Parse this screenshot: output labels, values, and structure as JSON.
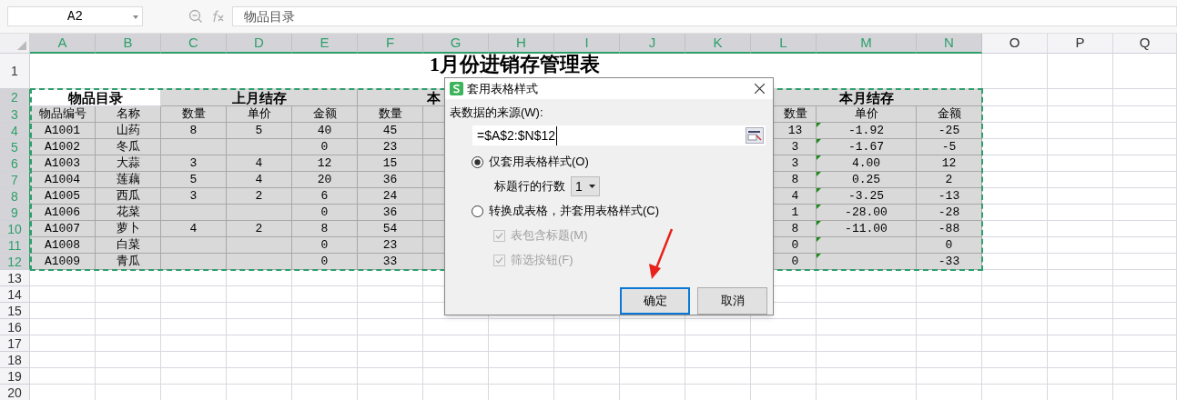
{
  "formula_bar": {
    "cell_ref": "A2",
    "formula": "物品目录"
  },
  "columns": [
    {
      "letter": "A",
      "selected": true
    },
    {
      "letter": "B",
      "selected": true
    },
    {
      "letter": "C",
      "selected": true
    },
    {
      "letter": "D",
      "selected": true
    },
    {
      "letter": "E",
      "selected": true
    },
    {
      "letter": "F",
      "selected": true
    },
    {
      "letter": "G",
      "selected": true
    },
    {
      "letter": "H",
      "selected": true
    },
    {
      "letter": "I",
      "selected": true
    },
    {
      "letter": "J",
      "selected": true
    },
    {
      "letter": "K",
      "selected": true
    },
    {
      "letter": "L",
      "selected": true
    },
    {
      "letter": "M",
      "selected": true
    },
    {
      "letter": "N",
      "selected": true
    },
    {
      "letter": "O",
      "selected": false
    },
    {
      "letter": "P",
      "selected": false
    },
    {
      "letter": "Q",
      "selected": false
    }
  ],
  "sheet": {
    "title_row": {
      "number": "1",
      "selected": false,
      "title": "1月份进销存管理表"
    },
    "group_row": {
      "number": "2",
      "selected": true,
      "groups": [
        {
          "text": "物品目录"
        },
        {
          "text": "上月结存"
        },
        {
          "text": "本"
        },
        {
          "text": "本月结存"
        }
      ]
    },
    "header_row": {
      "number": "3",
      "selected": true,
      "cells": [
        "物品编号",
        "名称",
        "数量",
        "单价",
        "金额",
        "数量",
        null,
        null,
        null,
        null,
        null,
        "数量",
        "单价",
        "金额"
      ]
    },
    "rows": [
      {
        "number": "4",
        "selected": true,
        "flagged": true,
        "cells": [
          "A1001",
          "山药",
          "8",
          "5",
          "40",
          "45",
          null,
          null,
          null,
          null,
          null,
          "13",
          "-1.92",
          "-25"
        ]
      },
      {
        "number": "5",
        "selected": true,
        "flagged": true,
        "cells": [
          "A1002",
          "冬瓜",
          null,
          null,
          "0",
          "23",
          null,
          null,
          null,
          null,
          null,
          "3",
          "-1.67",
          "-5"
        ]
      },
      {
        "number": "6",
        "selected": true,
        "flagged": true,
        "cells": [
          "A1003",
          "大蒜",
          "3",
          "4",
          "12",
          "15",
          null,
          null,
          null,
          null,
          null,
          "3",
          "4.00",
          "12"
        ]
      },
      {
        "number": "7",
        "selected": true,
        "flagged": true,
        "cells": [
          "A1004",
          "莲藕",
          "5",
          "4",
          "20",
          "36",
          null,
          null,
          null,
          null,
          null,
          "8",
          "0.25",
          "2"
        ]
      },
      {
        "number": "8",
        "selected": true,
        "flagged": true,
        "cells": [
          "A1005",
          "西瓜",
          "3",
          "2",
          "6",
          "24",
          null,
          null,
          null,
          null,
          null,
          "4",
          "-3.25",
          "-13"
        ]
      },
      {
        "number": "9",
        "selected": true,
        "flagged": true,
        "cells": [
          "A1006",
          "花菜",
          null,
          null,
          "0",
          "36",
          null,
          null,
          null,
          null,
          null,
          "1",
          "-28.00",
          "-28"
        ]
      },
      {
        "number": "10",
        "selected": true,
        "flagged": true,
        "cells": [
          "A1007",
          "萝卜",
          "4",
          "2",
          "8",
          "54",
          null,
          null,
          null,
          null,
          null,
          "8",
          "-11.00",
          "-88"
        ]
      },
      {
        "number": "11",
        "selected": true,
        "flagged": true,
        "cells": [
          "A1008",
          "白菜",
          null,
          null,
          "0",
          "23",
          null,
          null,
          null,
          null,
          null,
          "0",
          null,
          "0"
        ]
      },
      {
        "number": "12",
        "selected": true,
        "flagged": true,
        "cells": [
          "A1009",
          "青瓜",
          null,
          null,
          "0",
          "33",
          null,
          null,
          null,
          null,
          null,
          "0",
          null,
          "-33"
        ]
      }
    ],
    "empty_rows": [
      {
        "number": "13",
        "selected": false
      },
      {
        "number": "14",
        "selected": false
      },
      {
        "number": "15",
        "selected": false
      },
      {
        "number": "16",
        "selected": false
      },
      {
        "number": "17",
        "selected": false
      },
      {
        "number": "18",
        "selected": false
      },
      {
        "number": "19",
        "selected": false
      },
      {
        "number": "20",
        "selected": false
      }
    ]
  },
  "dialog": {
    "title": "套用表格样式",
    "source_label": "表数据的来源(W):",
    "source_value": "=$A$2:$N$12",
    "options": [
      {
        "label": "仅套用表格样式(O)",
        "selected": true
      },
      {
        "label": "转换成表格，并套用表格样式(C)",
        "selected": false
      }
    ],
    "header_rows_label": "标题行的行数",
    "header_rows_value": "1",
    "checkboxes": [
      {
        "label": "表包含标题(M)",
        "checked": true,
        "disabled": true
      },
      {
        "label": "筛选按钮(F)",
        "checked": true,
        "disabled": true
      }
    ],
    "buttons": [
      {
        "label": "确定",
        "default": true
      },
      {
        "label": "取消",
        "default": false
      }
    ]
  }
}
